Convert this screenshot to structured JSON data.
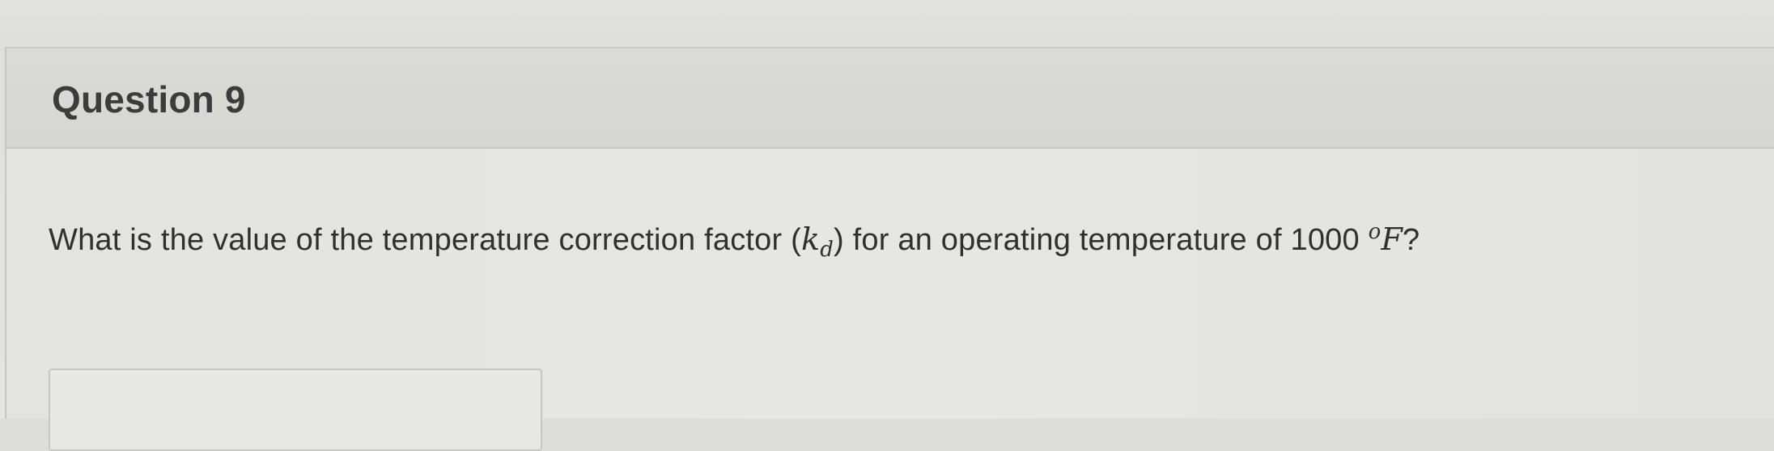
{
  "question": {
    "title": "Question 9",
    "prompt_before": "What is the value of the temperature correction factor (",
    "kd_symbol": "k",
    "kd_subscript": "d",
    "prompt_middle": ") for an operating temperature of 1000 ",
    "degree_symbol": "o",
    "unit_symbol": "F",
    "prompt_end": "?",
    "answer_value": ""
  }
}
